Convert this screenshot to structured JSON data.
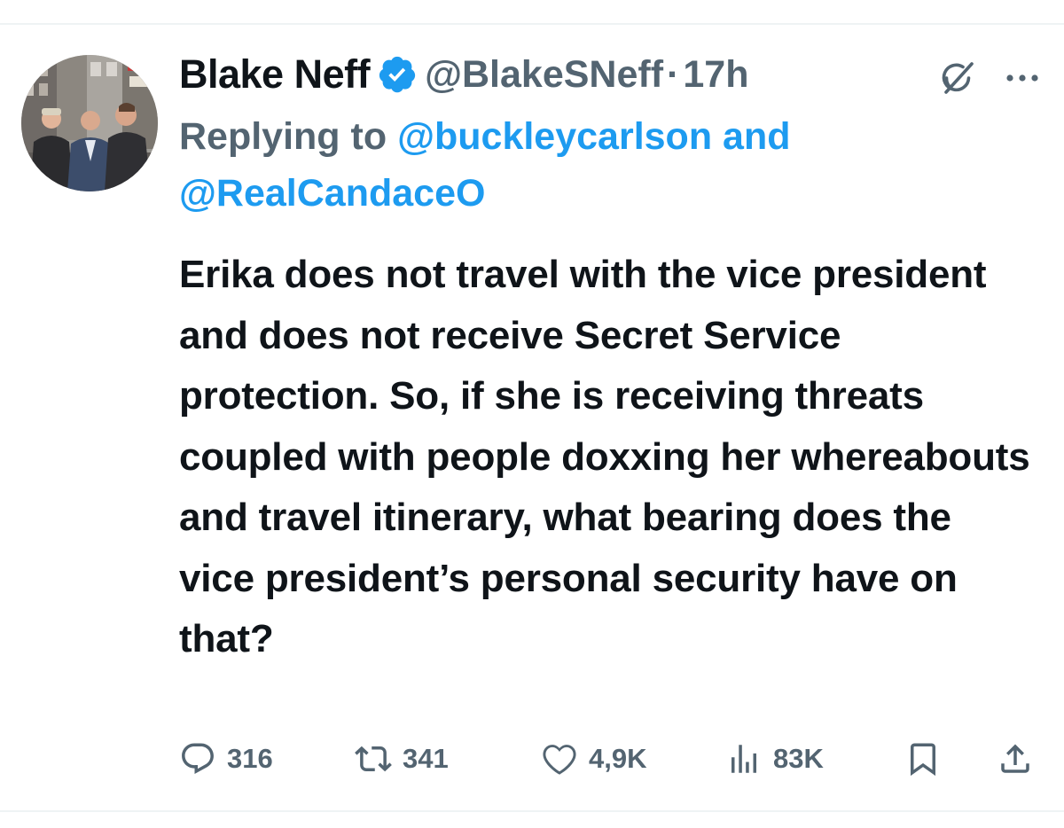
{
  "tweet": {
    "author": {
      "display_name": "Blake Neff",
      "handle": "@BlakeSNeff",
      "verified": true
    },
    "separator": "·",
    "time": "17h",
    "reply": {
      "prefix": "Replying to",
      "mention_1": "@buckleycarlson",
      "conjunction": "and",
      "mention_2": "@RealCandaceO"
    },
    "text": "Erika does not travel with the vice president and does not receive Secret Service protection. So, if she is receiving threats coupled with people doxxing her whereabouts and travel itinerary, what bearing does the vice president’s personal security have on that?",
    "metrics": {
      "replies": "316",
      "reposts": "341",
      "likes": "4,9K",
      "views": "83K"
    }
  },
  "colors": {
    "text_primary": "#0f1419",
    "text_secondary": "#536471",
    "accent": "#1d9bf0",
    "divider": "#eff3f4"
  },
  "icons": {
    "verified": "verified-badge-icon",
    "grok": "grok-icon",
    "more": "more-icon",
    "reply": "reply-icon",
    "repost": "repost-icon",
    "like": "like-icon",
    "views": "views-icon",
    "bookmark": "bookmark-icon",
    "share": "share-icon"
  }
}
